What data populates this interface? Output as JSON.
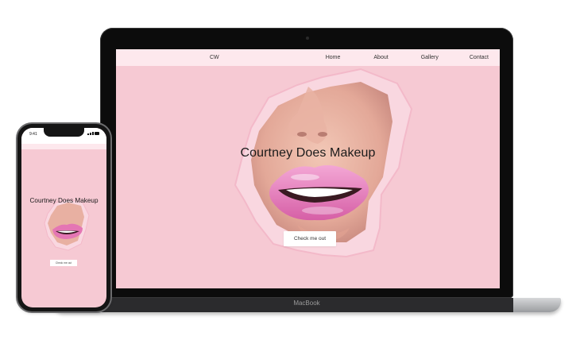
{
  "laptop": {
    "brand": "MacBook",
    "site": {
      "logo": "CW",
      "nav": [
        "Home",
        "About",
        "Gallery",
        "Contact"
      ],
      "hero_title": "Courtney Does Makeup",
      "cta_label": "Check me out"
    }
  },
  "phone": {
    "time": "9:41",
    "site": {
      "hero_title": "Courtney Does Makeup",
      "cta_label": "Check me out"
    }
  },
  "colors": {
    "background_pink": "#f6c9d3",
    "nav_pink": "#fde8ed",
    "lip_pink": "#e97bb6"
  }
}
